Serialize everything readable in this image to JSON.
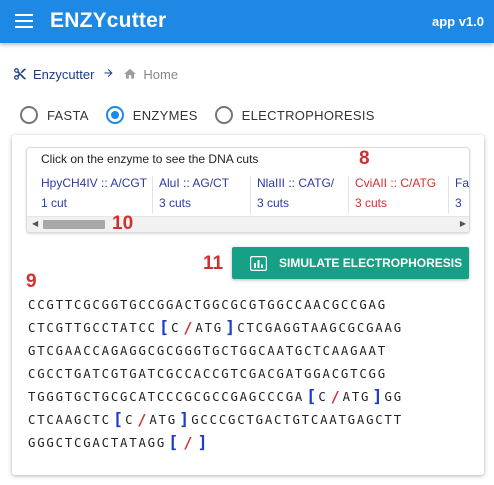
{
  "app": {
    "title": "ENZYcutter",
    "version": "app v1.0",
    "menu_icon": "menu-icon"
  },
  "breadcrumb": {
    "link_label": "Enzycutter",
    "link_icon": "scissors-icon",
    "separator_icon": "arrow-right-icon",
    "home_icon": "home-icon",
    "current_label": "Home"
  },
  "modes": {
    "selected": "ENZYMES",
    "options": [
      "FASTA",
      "ENZYMES",
      "ELECTROPHORESIS"
    ]
  },
  "enzymes": {
    "hint": "Click on the enzyme to see the DNA cuts",
    "selected": "CviAII :: C/ATG",
    "items": [
      {
        "name": "HpyCH4IV :: A/CGT",
        "cuts": "1 cut"
      },
      {
        "name": "AluI :: AG/CT",
        "cuts": "3 cuts"
      },
      {
        "name": "NlaIII :: CATG/",
        "cuts": "3 cuts"
      },
      {
        "name": "CviAII :: C/ATG",
        "cuts": "3 cuts"
      },
      {
        "name": "Fa",
        "cuts": "3"
      }
    ]
  },
  "annotations": {
    "a8": "8",
    "a9": "9",
    "a10": "10",
    "a11": "11"
  },
  "simulate_button": {
    "label": "SIMULATE ELECTROPHORESIS",
    "icon": "bar-chart-icon"
  },
  "sequence": {
    "lines": [
      [
        "CCGTTCGCGGTGCCGGACTGGCGCGTGGCCAACGCCGAG"
      ],
      [
        "CTCGTTGCCTATCC",
        "|C/ATG|",
        "CTCGAGGTAAGCGCGAAG"
      ],
      [
        "GTCGAACCAGAGGCGCGGGTGCTGGCAATGCTCAAGAAT"
      ],
      [
        "CGCCTGATCGTGATCGCCACCGTCGACGATGGACGTCGG"
      ],
      [
        "TGGGTGCTGCGCATCCCGCGCCGAGCCCGA",
        "|C/ATG|",
        "GG"
      ],
      [
        "CTCAAGCTC",
        "|C/ATG|",
        "GCCCGCTGACTGTCAATGAGCTT"
      ],
      [
        "GGGCTCGACTATAGG",
        "|/|"
      ]
    ],
    "colors": {
      "bracket": "#1e3cc8",
      "cut": "#d32f2f"
    }
  },
  "colors": {
    "appbar": "#1e88e5",
    "accent": "#1e88e5",
    "button": "#16a085",
    "selected_enzyme": "#d32f2f",
    "enzyme_link": "#2a3aa8"
  }
}
